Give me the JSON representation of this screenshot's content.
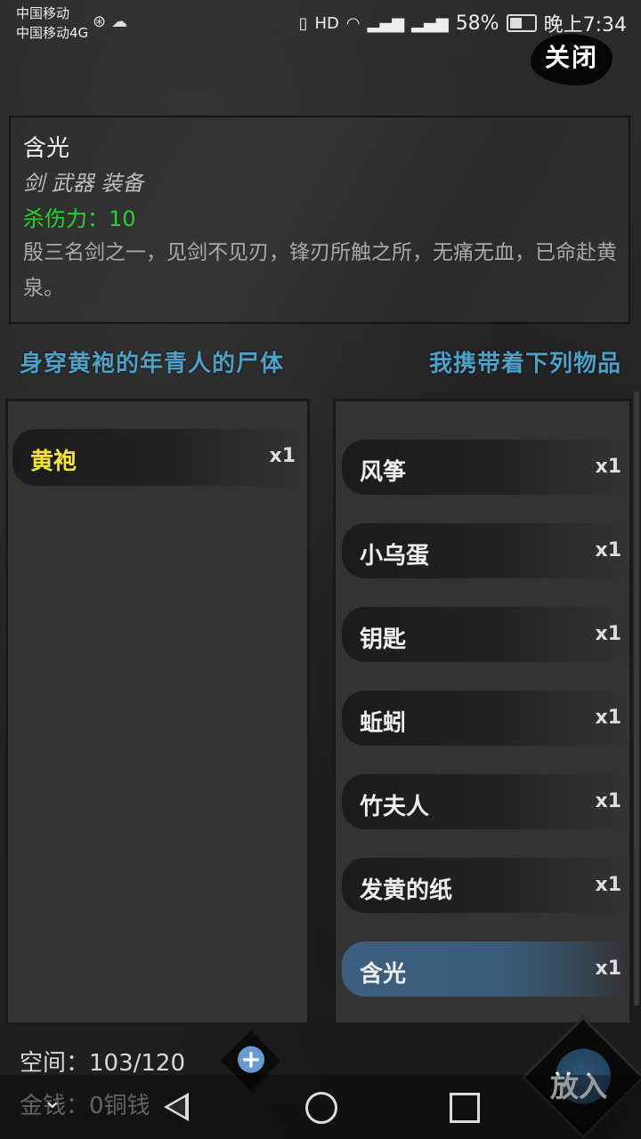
{
  "status_bar": {
    "carrier1": "中国移动",
    "carrier2": "中国移动4G",
    "battery": "58%",
    "time": "晚上7:34",
    "hd": "HD"
  },
  "close_button": "关闭",
  "item_info": {
    "name": "含光",
    "category": "剑 武器 装备",
    "attack": "杀伤力：10",
    "description": "殷三名剑之一，见剑不见刃，锋刃所触之所，无痛无血，已命赴黄泉。"
  },
  "left_header": "身穿黄袍的年青人的尸体",
  "right_header": "我携带着下列物品",
  "left_items": [
    {
      "label": "黄袍",
      "qty": "x1"
    }
  ],
  "right_items": [
    {
      "label": "风筝",
      "qty": "x1"
    },
    {
      "label": "小乌蛋",
      "qty": "x1"
    },
    {
      "label": "钥匙",
      "qty": "x1"
    },
    {
      "label": "蚯蚓",
      "qty": "x1"
    },
    {
      "label": "竹夫人",
      "qty": "x1"
    },
    {
      "label": "发黄的纸",
      "qty": "x1"
    },
    {
      "label": "含光",
      "qty": "x1",
      "selected": true
    }
  ],
  "space": "空间：103/120",
  "money": "金钱：0铜钱",
  "put_button": "放入",
  "colors": {
    "header": "#4f9fc7",
    "attack": "#27d22d",
    "selected_item": "#3c5f80",
    "left_item_label": "#f4e43a"
  }
}
